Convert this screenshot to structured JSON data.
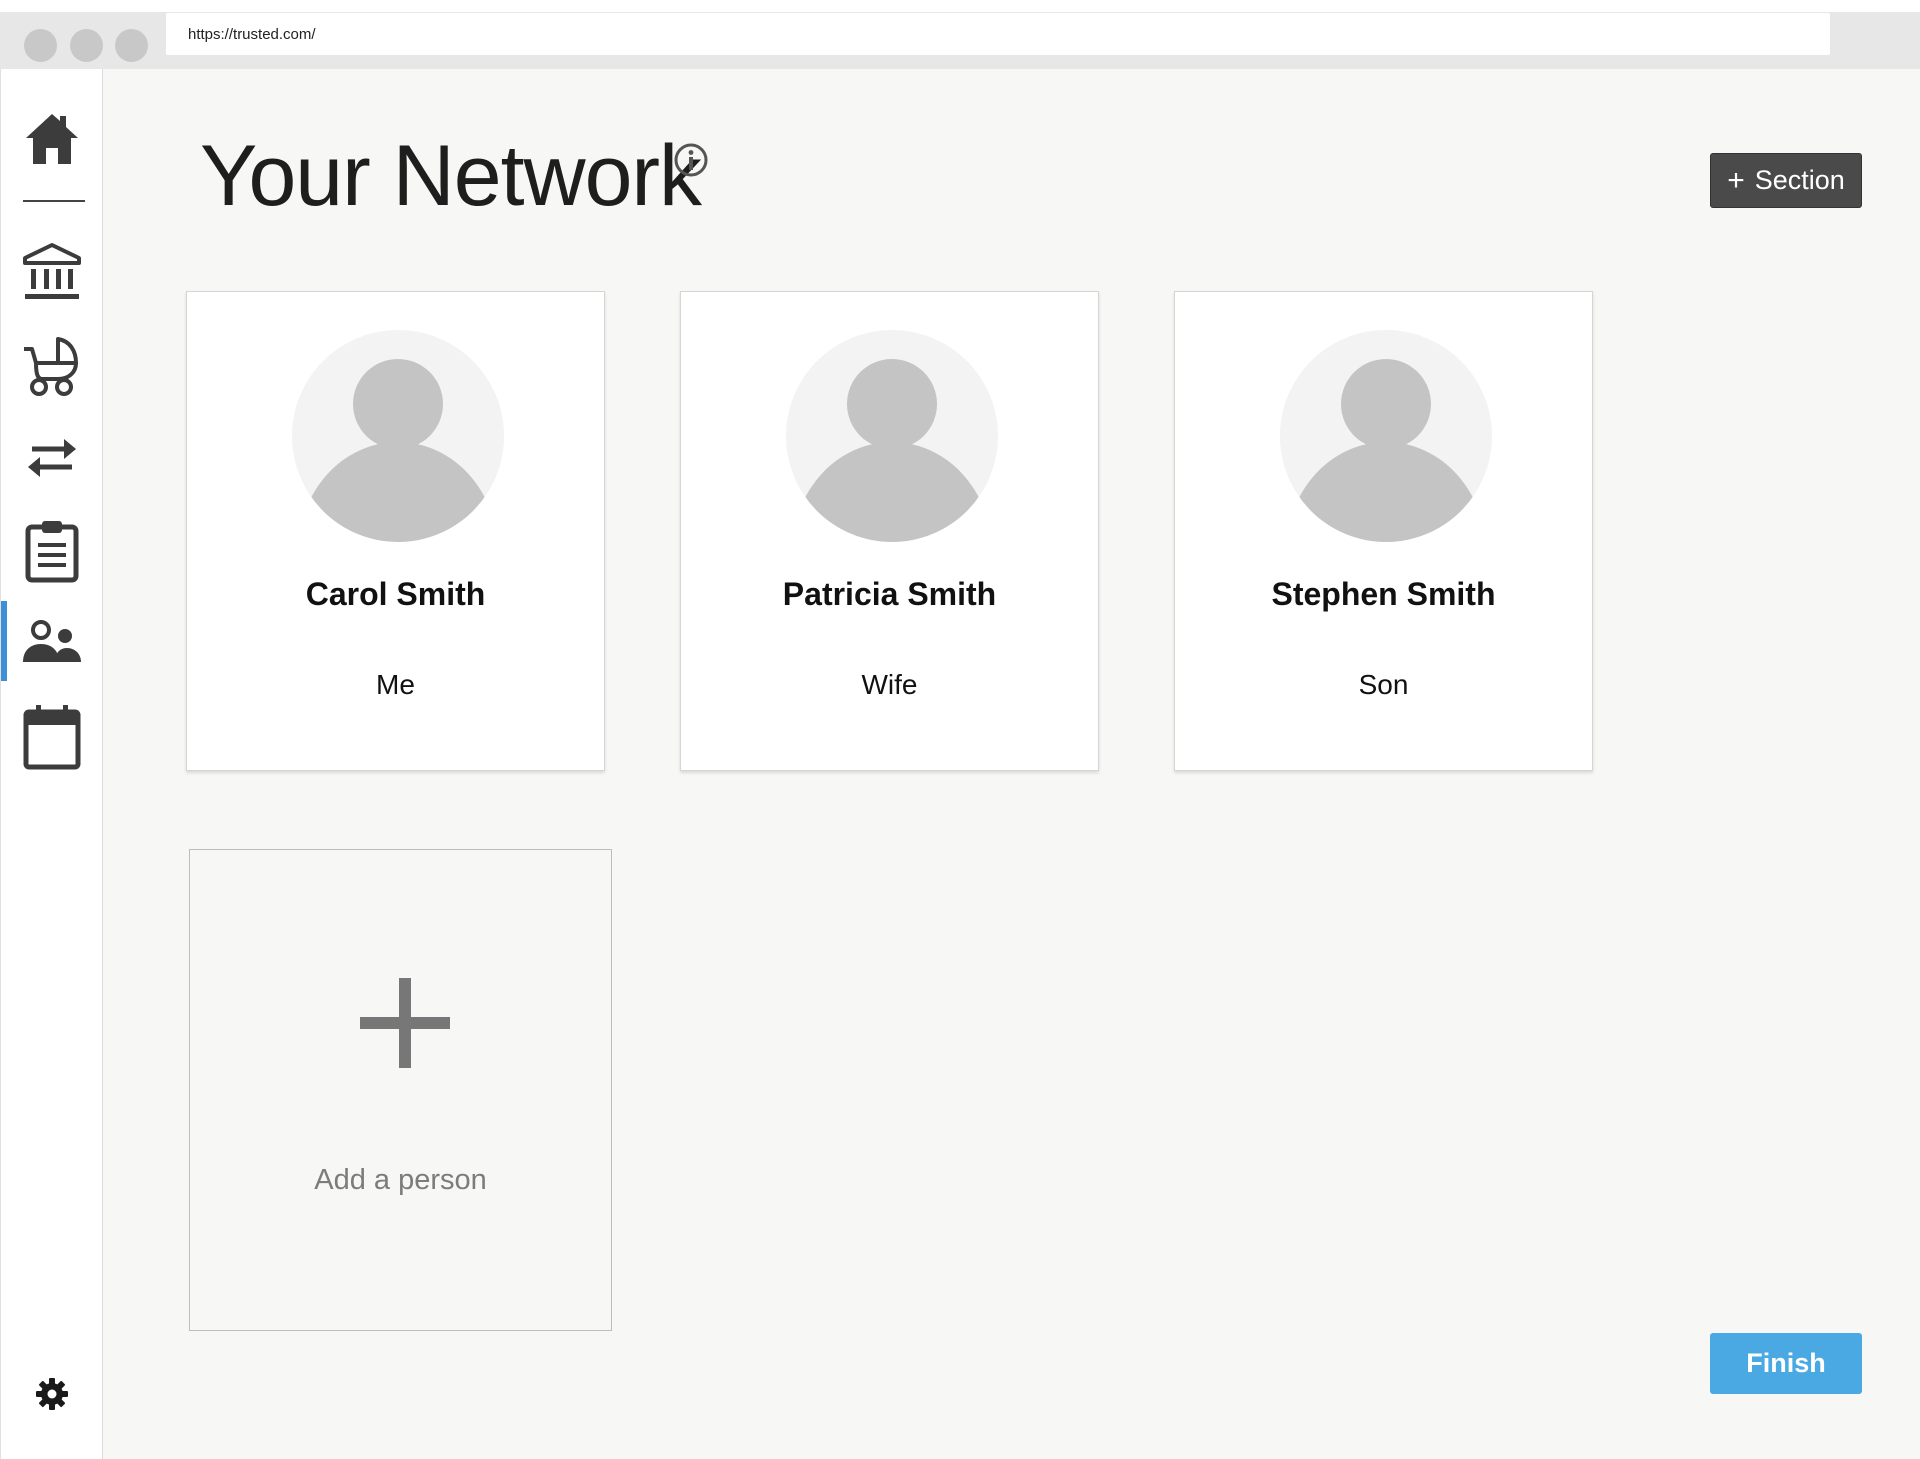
{
  "browser": {
    "url": "https://trusted.com/"
  },
  "sidebar": {
    "items": [
      {
        "icon": "home-icon"
      },
      {
        "icon": "bank-icon"
      },
      {
        "icon": "stroller-icon"
      },
      {
        "icon": "transfer-arrows-icon"
      },
      {
        "icon": "clipboard-icon"
      },
      {
        "icon": "people-icon",
        "active": true
      },
      {
        "icon": "calendar-icon"
      }
    ],
    "settings_icon": "gear-icon"
  },
  "main": {
    "title": "Your Network",
    "section_button": "Section",
    "section_button_icon": "+",
    "people": [
      {
        "name": "Carol Smith",
        "relation": "Me"
      },
      {
        "name": "Patricia Smith",
        "relation": "Wife"
      },
      {
        "name": "Stephen Smith",
        "relation": "Son"
      }
    ],
    "add_person_label": "Add a person",
    "finish_button": "Finish"
  },
  "colors": {
    "accent": "#3f8fd8",
    "finish": "#4aa8e2",
    "dark_button": "#4a4a4a",
    "background": "#f7f7f5"
  }
}
